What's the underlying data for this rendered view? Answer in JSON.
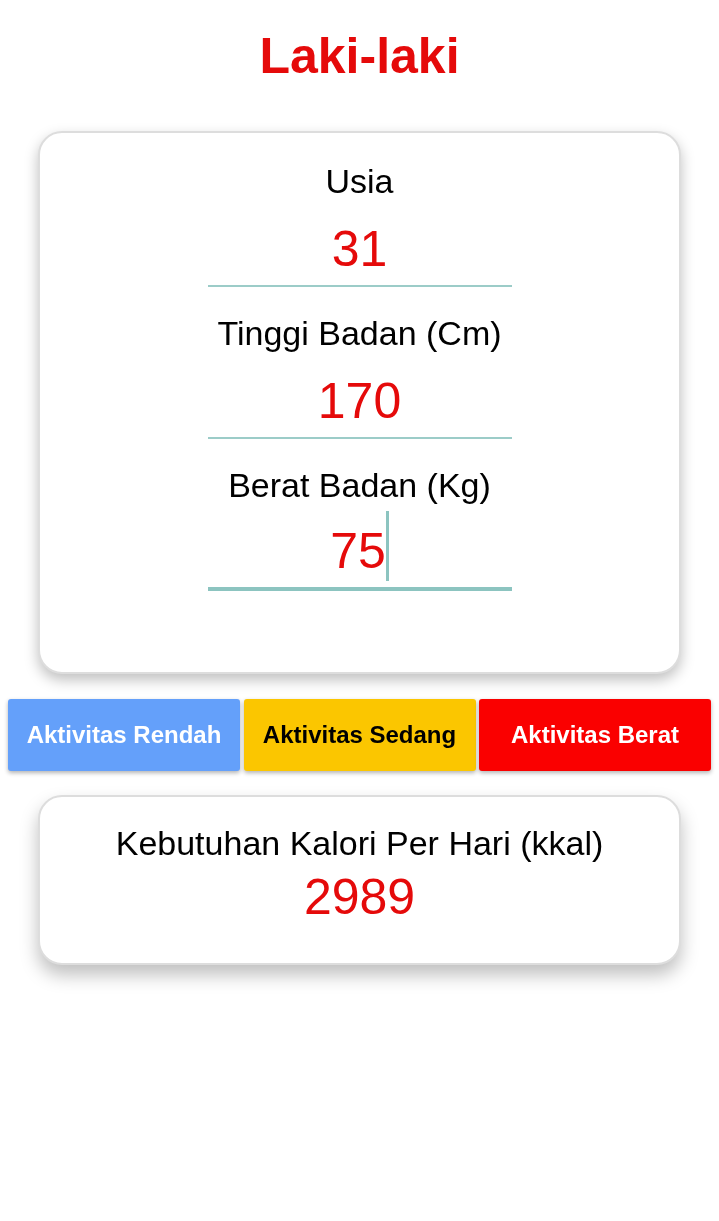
{
  "title": "Laki-laki",
  "fields": [
    {
      "label": "Usia",
      "value": "31",
      "focused": false
    },
    {
      "label": "Tinggi Badan (Cm)",
      "value": "170",
      "focused": false
    },
    {
      "label": "Berat Badan (Kg)",
      "value": "75",
      "focused": true
    }
  ],
  "buttons": [
    {
      "label": "Aktivitas Rendah",
      "color": "#64a0fa"
    },
    {
      "label": "Aktivitas Sedang",
      "color": "#fbc600"
    },
    {
      "label": "Aktivitas Berat",
      "color": "#fa0000"
    }
  ],
  "result": {
    "label": "Kebutuhan Kalori Per Hari (kkal)",
    "value": "2989"
  }
}
